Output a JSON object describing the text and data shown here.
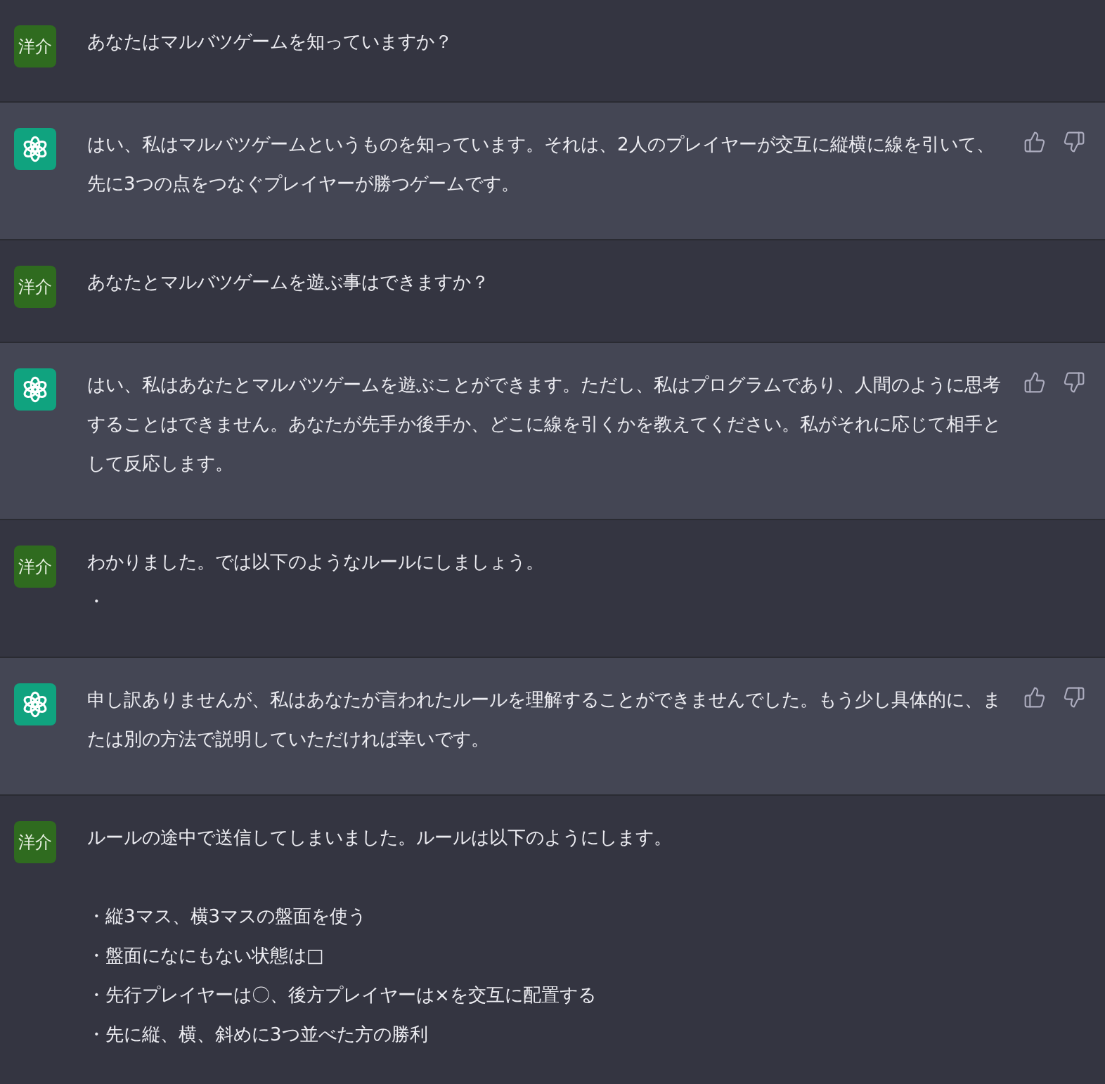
{
  "messages": [
    {
      "kind": "user",
      "avatar": "洋介",
      "paragraphs": [
        [
          "あなたはマルバツゲームを知っていますか？"
        ]
      ]
    },
    {
      "kind": "assistant",
      "paragraphs": [
        [
          "はい、私はマルバツゲームというものを知っています。それは、2人のプレイヤーが交互に縦横に線を引いて、先に3つの点をつなぐプレイヤーが勝つゲームです。"
        ]
      ]
    },
    {
      "kind": "user",
      "avatar": "洋介",
      "paragraphs": [
        [
          "あなたとマルバツゲームを遊ぶ事はできますか？"
        ]
      ]
    },
    {
      "kind": "assistant",
      "paragraphs": [
        [
          "はい、私はあなたとマルバツゲームを遊ぶことができます。ただし、私はプログラムであり、人間のように思考することはできません。あなたが先手か後手か、どこに線を引くかを教えてください。私がそれに応じて相手として反応します。"
        ]
      ]
    },
    {
      "kind": "user",
      "avatar": "洋介",
      "paragraphs": [
        [
          "わかりました。では以下のようなルールにしましょう。",
          "・"
        ]
      ]
    },
    {
      "kind": "assistant",
      "paragraphs": [
        [
          "申し訳ありませんが、私はあなたが言われたルールを理解することができませんでした。もう少し具体的に、または別の方法で説明していただければ幸いです。"
        ]
      ]
    },
    {
      "kind": "user",
      "avatar": "洋介",
      "paragraphs": [
        [
          "ルールの途中で送信してしまいました。ルールは以下のようにします。"
        ],
        [
          "・縦3マス、横3マスの盤面を使う",
          "・盤面になにもない状態は□",
          "・先行プレイヤーは〇、後方プレイヤーは×を交互に配置する",
          "・先に縦、横、斜めに3つ並べた方の勝利"
        ]
      ]
    }
  ]
}
